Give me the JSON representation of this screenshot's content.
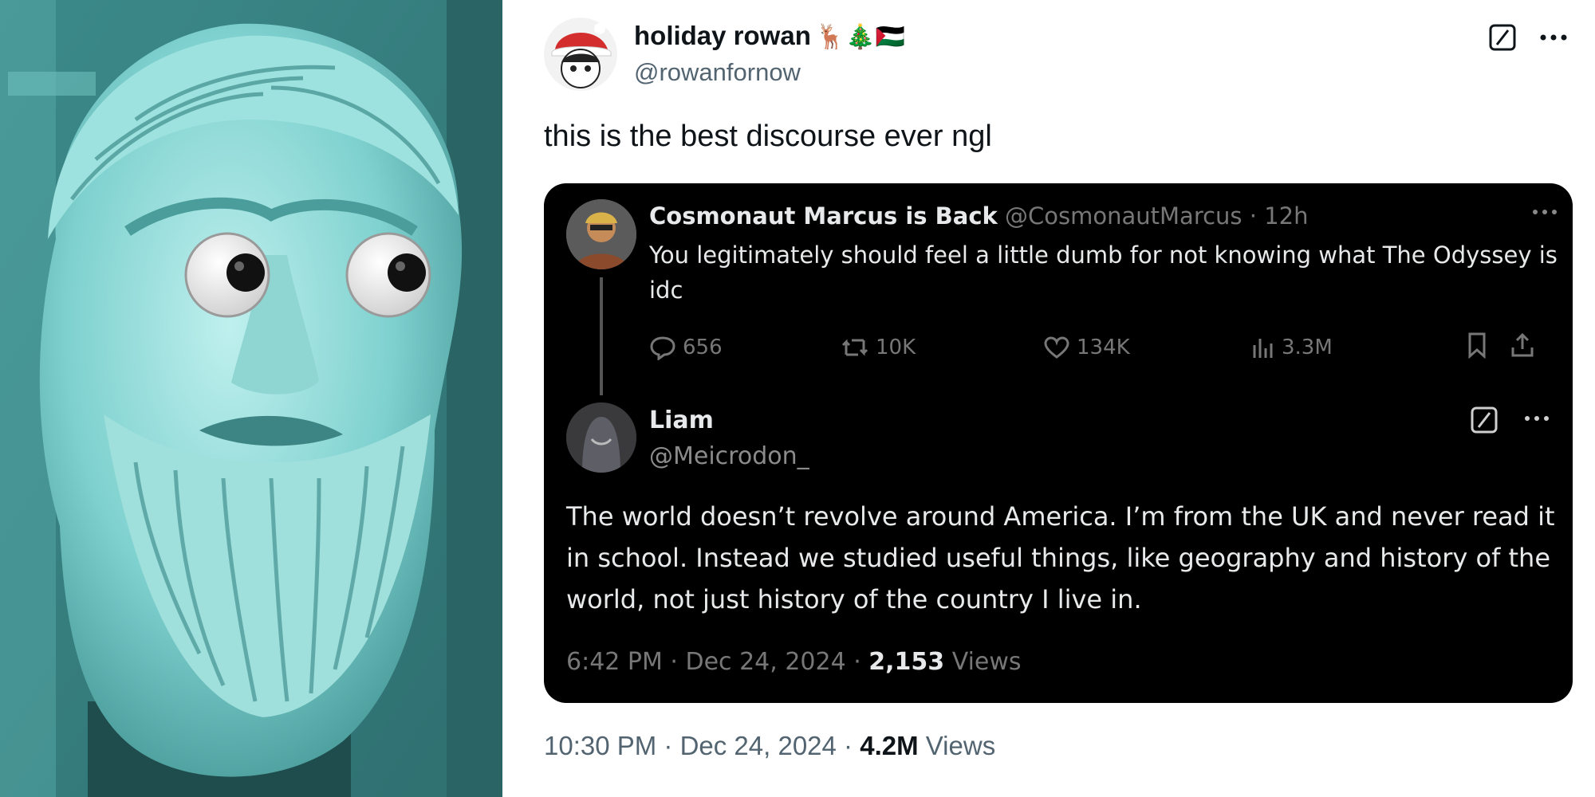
{
  "tweet": {
    "author_name": "holiday rowan",
    "author_emoji": "🦌🎄🇵🇸",
    "author_handle": "@rowanfornow",
    "text": "this is the best discourse ever ngl",
    "time": "10:30 PM · Dec 24, 2024 · ",
    "views_count": "4.2M",
    "views_label": " Views"
  },
  "quote_parent": {
    "author_name": "Cosmonaut Marcus is Back",
    "author_handle": "@CosmonautMarcus",
    "age": "· 12h",
    "text": "You legitimately should feel a little dumb for not knowing what The Odyssey is idc",
    "replies": "656",
    "reposts": "10K",
    "likes": "134K",
    "views": "3.3M"
  },
  "quote_reply": {
    "author_name": "Liam",
    "author_handle": "@Meicrodon_",
    "text": "The world doesn’t revolve around America.  I’m from the UK and never read it in school. Instead we studied useful things, like geography and history of the world, not just history of the country I live in.",
    "time": "6:42 PM · Dec 24, 2024 · ",
    "views_count": "2,153",
    "views_label": " Views"
  },
  "icons": [
    "grok-icon",
    "more-icon",
    "reply-icon",
    "repost-icon",
    "like-icon",
    "views-icon",
    "bookmark-icon",
    "share-icon"
  ],
  "colors": {
    "text_primary": "#0f1419",
    "text_secondary": "#536471",
    "card_bg": "#000000",
    "art_tint": "#4fa8a7"
  }
}
